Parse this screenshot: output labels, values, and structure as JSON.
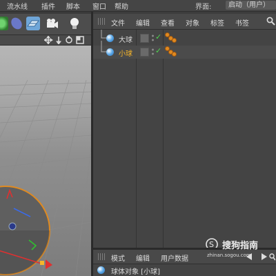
{
  "menubar": {
    "items": [
      "流水线",
      "插件",
      "脚本",
      "窗口",
      "帮助"
    ],
    "layout_label": "界面:",
    "layout_value": "启动（用户）"
  },
  "object_manager": {
    "menu": [
      "文件",
      "编辑",
      "查看",
      "对象",
      "标签",
      "书签"
    ],
    "objects": [
      {
        "name": "大球",
        "color": "#d8d8d8"
      },
      {
        "name": "小球",
        "color": "#f5b52a"
      }
    ]
  },
  "attribute_manager": {
    "menu": [
      "模式",
      "编辑",
      "用户数据"
    ],
    "title": "球体对象 [小球]"
  },
  "watermark": {
    "brand": "搜狗指南",
    "url": "zhinan.sogou.com"
  },
  "colors": {
    "accent_selected": "#f5b52a",
    "check": "#4fd64f",
    "tag": "#e08a20"
  }
}
